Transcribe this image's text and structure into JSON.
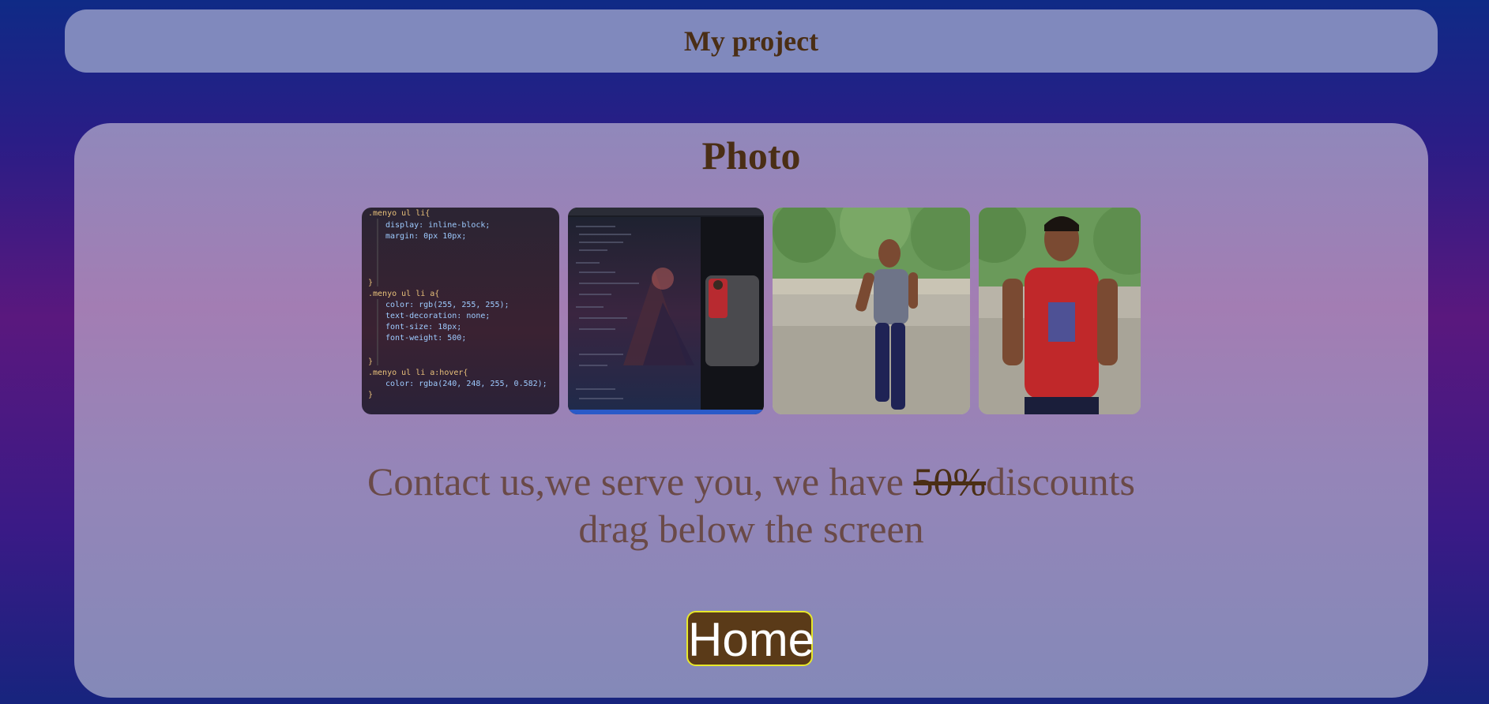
{
  "header": {
    "title": "My project"
  },
  "main": {
    "title": "Photo",
    "gallery": [
      {
        "alt": "code editor css screenshot"
      },
      {
        "alt": "code editor with preview screenshot"
      },
      {
        "alt": "photo boy grey shirt"
      },
      {
        "alt": "photo boy red shirt"
      }
    ],
    "code_lines": [
      ".menyo ul li{",
      "display: inline-block;",
      "margin: 0px 10px;",
      "}",
      ".menyo ul li a{",
      "color: rgb(255, 255, 255);",
      "text-decoration: none;",
      "font-size: 18px;",
      "font-weight: 500;",
      "}",
      ".menyo ul li a:hover{",
      "color: rgba(240, 248, 255, 0.582);",
      "}"
    ],
    "contact": {
      "text_before": "Contact us,we serve you, we have ",
      "strike": "50%",
      "text_after": "discounts",
      "line2": "drag below the screen"
    },
    "home_button": "Home"
  },
  "colors": {
    "header_bg": "#8089bd",
    "title_text": "#4a2e15",
    "contact_text": "#6a4a48",
    "button_bg": "#5a3a18",
    "button_border": "#e8e82a"
  }
}
